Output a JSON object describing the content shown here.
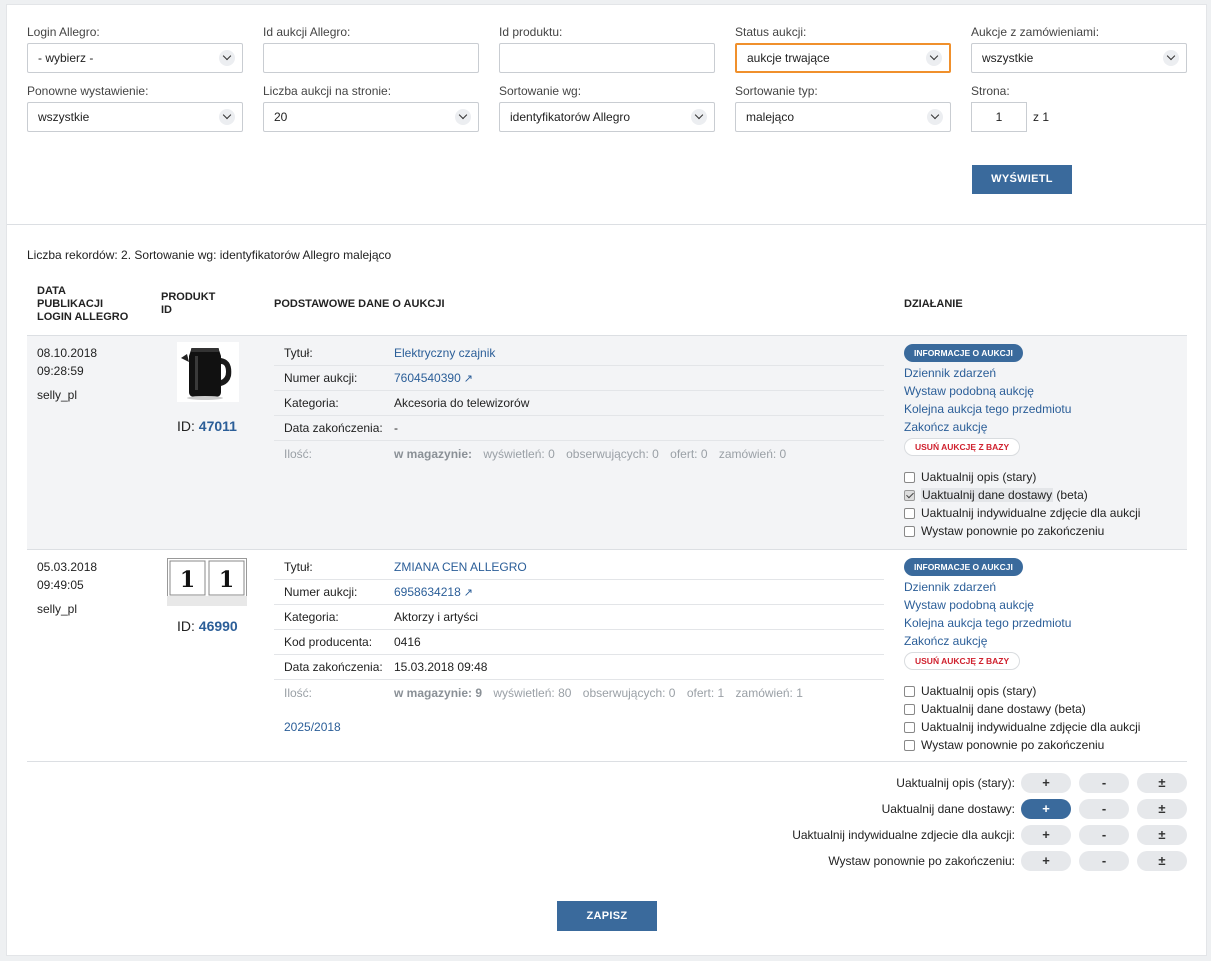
{
  "filters": {
    "login_label": "Login Allegro:",
    "login_value": "- wybierz -",
    "auction_id_label": "Id aukcji Allegro:",
    "auction_id_value": "",
    "product_id_label": "Id produktu:",
    "product_id_value": "",
    "status_label": "Status aukcji:",
    "status_value": "aukcje trwające",
    "orders_label": "Aukcje z zamówieniami:",
    "orders_value": "wszystkie",
    "relist_label": "Ponowne wystawienie:",
    "relist_value": "wszystkie",
    "per_page_label": "Liczba aukcji na stronie:",
    "per_page_value": "20",
    "sort_by_label": "Sortowanie wg:",
    "sort_by_value": "identyfikatorów Allegro",
    "sort_type_label": "Sortowanie typ:",
    "sort_type_value": "malejąco",
    "page_label": "Strona:",
    "page_value": "1",
    "page_of": "z 1",
    "show_button": "WYŚWIETL"
  },
  "summary": "Liczba rekordów: 2. Sortowanie wg: identyfikatorów Allegro malejąco",
  "headers": {
    "date_1": "DATA",
    "date_2": "PUBLIKACJI",
    "date_3": "LOGIN ALLEGRO",
    "product_1": "PRODUKT",
    "product_2": "ID",
    "basic": "PODSTAWOWE DANE O AUKCJI",
    "action": "DZIAŁANIE"
  },
  "rows": [
    {
      "date": "08.10.2018",
      "time": "09:28:59",
      "login": "selly_pl",
      "id_prefix": "ID:",
      "product_id": "47011",
      "details": [
        {
          "k": "Tytuł:",
          "v": "Elektryczny czajnik"
        },
        {
          "k": "Numer aukcji:",
          "v": "7604540390"
        },
        {
          "k": "Kategoria:",
          "v": "Akcesoria do telewizorów"
        },
        {
          "k": "Data zakończenia:",
          "v": "-"
        }
      ],
      "qty": {
        "label": "Ilość:",
        "stock": "w magazynie:",
        "views": "wyświetleń: 0",
        "watch": "obserwujących: 0",
        "offers": "ofert: 0",
        "orders": "zamówień: 0"
      }
    },
    {
      "date": "05.03.2018",
      "time": "09:49:05",
      "login": "selly_pl",
      "id_prefix": "ID:",
      "product_id": "46990",
      "details": [
        {
          "k": "Tytuł:",
          "v": "ZMIANA CEN ALLEGRO"
        },
        {
          "k": "Numer aukcji:",
          "v": "6958634218"
        },
        {
          "k": "Kategoria:",
          "v": "Aktorzy i artyści"
        },
        {
          "k": "Kod producenta:",
          "v": "0416"
        },
        {
          "k": "Data zakończenia:",
          "v": "15.03.2018 09:48"
        }
      ],
      "qty": {
        "label": "Ilość:",
        "stock": "w magazynie: 9",
        "views": "wyświetleń: 80",
        "watch": "obserwujących: 0",
        "offers": "ofert: 1",
        "orders": "zamówień: 1"
      },
      "extra_link": "2025/2018",
      "thumb_digits": [
        "1",
        "1"
      ]
    }
  ],
  "actions": {
    "info": "INFORMACJE O AUKCJI",
    "log": "Dziennik zdarzeń",
    "similar": "Wystaw podobną aukcję",
    "next": "Kolejna aukcja tego przedmiotu",
    "end": "Zakończ aukcję",
    "delete": "USUŃ AUKCJĘ Z BAZY",
    "chk_desc": "Uaktualnij opis (stary)",
    "chk_ship_main": "Uaktualnij dane dostawy",
    "chk_ship_suffix": "(beta)",
    "chk_photo": "Uaktualnij indywidualne zdjęcie dla aukcji",
    "chk_relist": "Wystaw ponownie po zakończeniu"
  },
  "checkbox_states": {
    "row1": [
      false,
      true,
      false,
      false
    ],
    "row2": [
      false,
      false,
      false,
      false
    ]
  },
  "bulk": {
    "desc": "Uaktualnij opis (stary):",
    "ship": "Uaktualnij dane dostawy:",
    "photo": "Uaktualnij indywidualne zdjecie dla aukcji:",
    "relist": "Wystaw ponownie po zakończeniu:",
    "plus": "+",
    "minus": "-",
    "plusminus": "±",
    "selected_row": "ship",
    "selected_button": "plus"
  },
  "save_button": "ZAPISZ",
  "colors": {
    "accent": "#3a6a9c",
    "link": "#2b5e98",
    "active_border": "#f0902c",
    "danger": "#d0212e"
  }
}
